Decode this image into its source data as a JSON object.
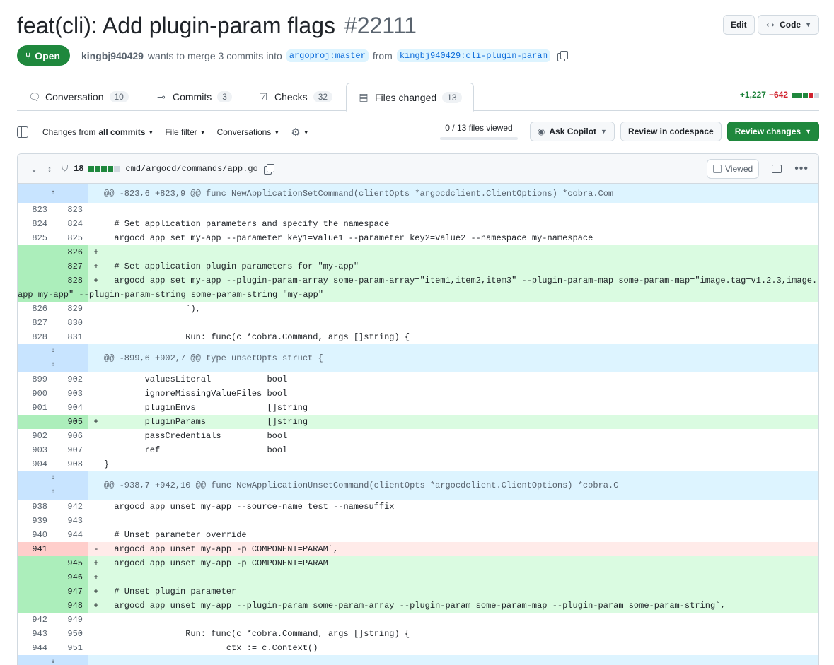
{
  "header": {
    "title": "feat(cli): Add plugin-param flags",
    "number": "#22111",
    "edit_label": "Edit",
    "code_label": "Code"
  },
  "meta": {
    "state": "Open",
    "author": "kingbj940429",
    "action_text": "wants to merge 3 commits into",
    "base_branch": "argoproj:master",
    "from_text": "from",
    "head_branch": "kingbj940429:cli-plugin-param"
  },
  "tabs": [
    {
      "label": "Conversation",
      "count": "10",
      "icon": "comment-icon"
    },
    {
      "label": "Commits",
      "count": "3",
      "icon": "commit-icon"
    },
    {
      "label": "Checks",
      "count": "32",
      "icon": "checklist-icon"
    },
    {
      "label": "Files changed",
      "count": "13",
      "icon": "file-diff-icon"
    }
  ],
  "diffstat": {
    "additions": "+1,227",
    "deletions": "−642"
  },
  "toolbar": {
    "changes_from": "Changes from",
    "all_commits": "all commits",
    "file_filter": "File filter",
    "conversations": "Conversations",
    "files_viewed": "0 / 13 files viewed",
    "ask_copilot": "Ask Copilot",
    "review_codespace": "Review in codespace",
    "review_changes": "Review changes"
  },
  "file": {
    "changes": "18",
    "path": "cmd/argocd/commands/app.go",
    "viewed_label": "Viewed"
  },
  "hunks": {
    "h1": "@@ -823,6 +823,9 @@ func NewApplicationSetCommand(clientOpts *argocdclient.ClientOptions) *cobra.Com",
    "h2": "@@ -899,6 +902,7 @@ type unsetOpts struct {",
    "h3": "@@ -938,7 +942,10 @@ func NewApplicationUnsetCommand(clientOpts *argocdclient.ClientOptions) *cobra.C"
  },
  "lines": [
    {
      "o": "823",
      "n": "823",
      "m": "",
      "c": ""
    },
    {
      "o": "824",
      "n": "824",
      "m": "",
      "c": "  # Set application parameters and specify the namespace"
    },
    {
      "o": "825",
      "n": "825",
      "m": "",
      "c": "  argocd app set my-app --parameter key1=value1 --parameter key2=value2 --namespace my-namespace"
    },
    {
      "o": "",
      "n": "826",
      "m": "+",
      "c": ""
    },
    {
      "o": "",
      "n": "827",
      "m": "+",
      "c": "  # Set application plugin parameters for \"my-app\""
    },
    {
      "o": "",
      "n": "828",
      "m": "+",
      "c": "  argocd app set my-app --plugin-param-array some-param-array=\"item1,item2,item3\" --plugin-param-map some-param-map=\"image.tag=v1.2.3,image.app=my-app\" --plugin-param-string some-param-string=\"my-app\""
    },
    {
      "o": "826",
      "n": "829",
      "m": "",
      "c": "                `),"
    },
    {
      "o": "827",
      "n": "830",
      "m": "",
      "c": ""
    },
    {
      "o": "828",
      "n": "831",
      "m": "",
      "c": "                Run: func(c *cobra.Command, args []string) {"
    },
    {
      "o": "899",
      "n": "902",
      "m": "",
      "c": "        valuesLiteral           bool"
    },
    {
      "o": "900",
      "n": "903",
      "m": "",
      "c": "        ignoreMissingValueFiles bool"
    },
    {
      "o": "901",
      "n": "904",
      "m": "",
      "c": "        pluginEnvs              []string"
    },
    {
      "o": "",
      "n": "905",
      "m": "+",
      "c": "        pluginParams            []string"
    },
    {
      "o": "902",
      "n": "906",
      "m": "",
      "c": "        passCredentials         bool"
    },
    {
      "o": "903",
      "n": "907",
      "m": "",
      "c": "        ref                     bool"
    },
    {
      "o": "904",
      "n": "908",
      "m": "",
      "c": "}"
    },
    {
      "o": "938",
      "n": "942",
      "m": "",
      "c": "  argocd app unset my-app --source-name test --namesuffix"
    },
    {
      "o": "939",
      "n": "943",
      "m": "",
      "c": ""
    },
    {
      "o": "940",
      "n": "944",
      "m": "",
      "c": "  # Unset parameter override"
    },
    {
      "o": "941",
      "n": "",
      "m": "-",
      "c": "  argocd app unset my-app -p COMPONENT=PARAM`,"
    },
    {
      "o": "",
      "n": "945",
      "m": "+",
      "c": "  argocd app unset my-app -p COMPONENT=PARAM"
    },
    {
      "o": "",
      "n": "946",
      "m": "+",
      "c": ""
    },
    {
      "o": "",
      "n": "947",
      "m": "+",
      "c": "  # Unset plugin parameter"
    },
    {
      "o": "",
      "n": "948",
      "m": "+",
      "c": "  argocd app unset my-app --plugin-param some-param-array --plugin-param some-param-map --plugin-param some-param-string`,"
    },
    {
      "o": "942",
      "n": "949",
      "m": "",
      "c": ""
    },
    {
      "o": "943",
      "n": "950",
      "m": "",
      "c": "                Run: func(c *cobra.Command, args []string) {"
    },
    {
      "o": "944",
      "n": "951",
      "m": "",
      "c": "                        ctx := c.Context()"
    }
  ],
  "colors": {
    "green": "#1f883d",
    "add_bg": "#dafbe1",
    "del_bg": "#ffebe9",
    "hunk_bg": "#ddf4ff"
  }
}
